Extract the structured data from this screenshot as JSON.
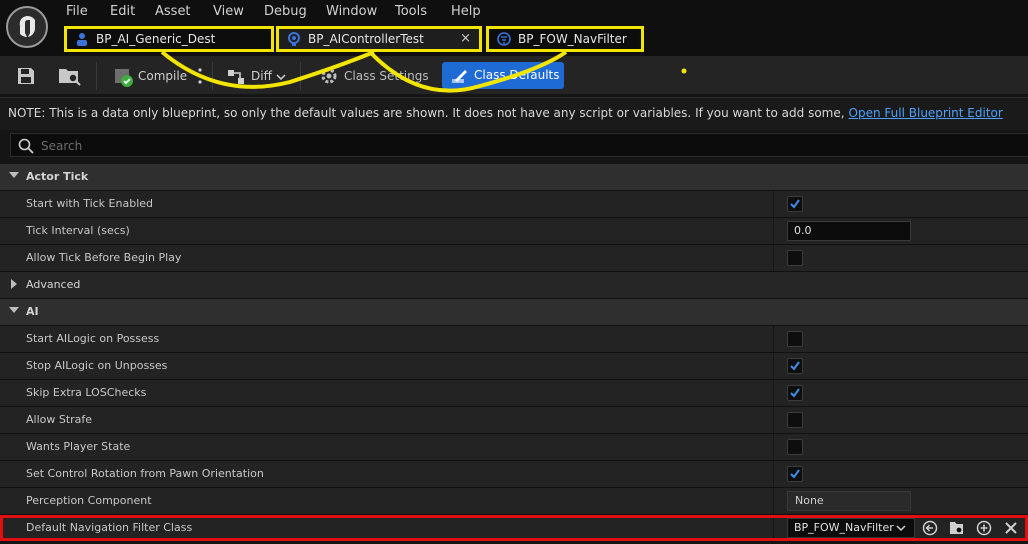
{
  "menu": [
    "File",
    "Edit",
    "Asset",
    "View",
    "Debug",
    "Window",
    "Tools",
    "Help"
  ],
  "tabs": [
    {
      "label": "BP_AI_Generic_Dest"
    },
    {
      "label": "BP_AIControllerTest",
      "close": "×"
    },
    {
      "label": "BP_FOW_NavFilter"
    }
  ],
  "toolbar": {
    "compile": "Compile",
    "diff": "Diff",
    "class_settings": "Class Settings",
    "class_defaults": "Class Defaults"
  },
  "note": {
    "text": "NOTE: This is a data only blueprint, so only the default values are shown.  It does not have any script or variables.  If you want to add some,",
    "link": "Open Full Blueprint Editor"
  },
  "search": {
    "placeholder": "Search",
    "value": ""
  },
  "categories": {
    "actor_tick": "Actor Tick",
    "advanced": "Advanced",
    "ai": "AI"
  },
  "props": {
    "start_tick": {
      "label": "Start with Tick Enabled",
      "checked": true
    },
    "tick_interval": {
      "label": "Tick Interval (secs)",
      "value": "0.0"
    },
    "allow_tick": {
      "label": "Allow Tick Before Begin Play",
      "checked": false
    },
    "start_ailogic": {
      "label": "Start AILogic on Possess",
      "checked": false
    },
    "stop_ailogic": {
      "label": "Stop AILogic on Unposses",
      "checked": true
    },
    "skip_los": {
      "label": "Skip Extra LOSChecks",
      "checked": true
    },
    "allow_strafe": {
      "label": "Allow Strafe",
      "checked": false
    },
    "wants_player_state": {
      "label": "Wants Player State",
      "checked": false
    },
    "set_control_rotation": {
      "label": "Set Control Rotation from Pawn Orientation",
      "checked": true
    },
    "perception": {
      "label": "Perception Component",
      "value": "None"
    },
    "default_nav_filter": {
      "label": "Default Navigation Filter Class",
      "value": "BP_FOW_NavFilter"
    }
  },
  "colors": {
    "accent": "#1f6bd6",
    "highlight_yellow": "#f2e600",
    "highlight_red": "#e01010"
  }
}
